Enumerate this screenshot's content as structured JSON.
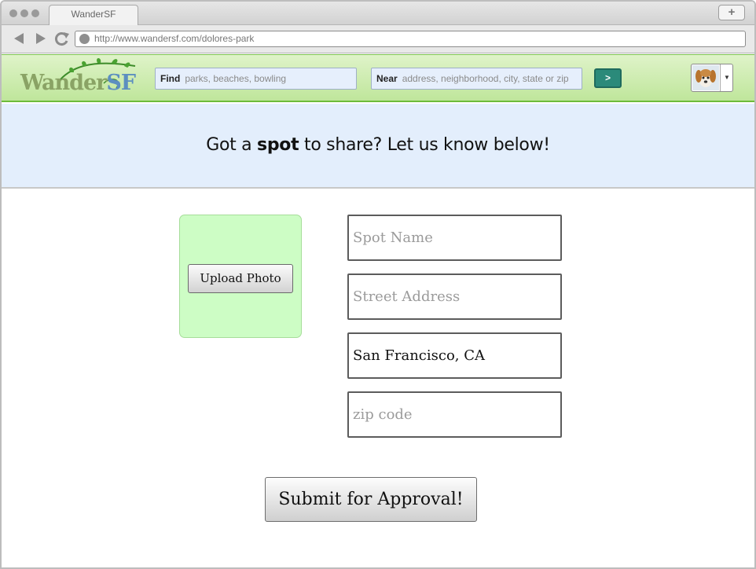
{
  "browser": {
    "tab_title": "WanderSF",
    "new_tab_label": "+",
    "url": "http://www.wandersf.com/dolores-park"
  },
  "header": {
    "logo_main": "Wander",
    "logo_accent": "SF",
    "find_label": "Find",
    "find_placeholder": "parks, beaches, bowling",
    "near_label": "Near",
    "near_placeholder": "address, neighborhood, city, state or zip",
    "go_label": ">",
    "avatar_arrow": "▼"
  },
  "banner": {
    "prefix": "Got a ",
    "emphasis": "spot",
    "suffix": " to share? Let us know below!"
  },
  "form": {
    "upload_label": "Upload Photo",
    "spot_name_placeholder": "Spot Name",
    "street_placeholder": "Street Address",
    "city_value": "San Francisco, CA",
    "zip_placeholder": "zip code",
    "submit_label": "Submit for Approval!"
  },
  "colors": {
    "header_green": "#bfe69b",
    "banner_blue": "#e3eefc",
    "photo_green": "#cdfdc5",
    "go_button": "#2b8a7a"
  }
}
